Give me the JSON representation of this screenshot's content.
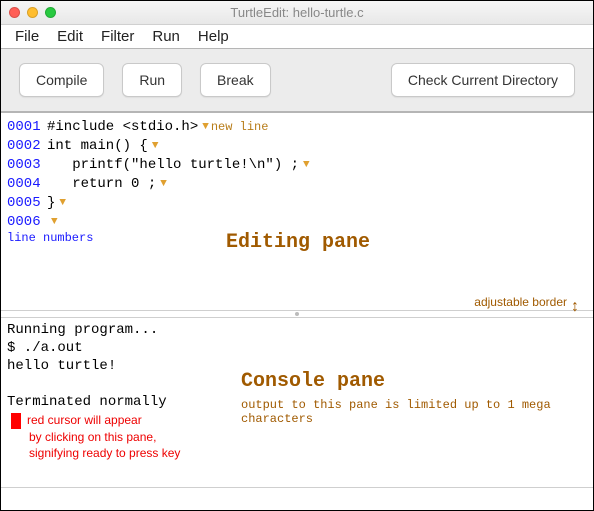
{
  "window": {
    "title": "TurtleEdit: hello-turtle.c"
  },
  "menubar": {
    "items": [
      "File",
      "Edit",
      "Filter",
      "Run",
      "Help"
    ]
  },
  "toolbar": {
    "compile": "Compile",
    "run": "Run",
    "break": "Break",
    "check": "Check Current Directory"
  },
  "editor": {
    "lines": [
      {
        "n": "0001",
        "code": "#include <stdio.h>",
        "tri": true,
        "annot": "new line"
      },
      {
        "n": "0002",
        "code": "int main() {",
        "tri": true
      },
      {
        "n": "0003",
        "code": "   printf(\"hello turtle!\\n\") ;",
        "tri": true
      },
      {
        "n": "0004",
        "code": "   return 0 ;",
        "tri": true
      },
      {
        "n": "0005",
        "code": "}",
        "tri": true
      },
      {
        "n": "0006",
        "code": "",
        "tri": true
      }
    ],
    "line_numbers_label": "line numbers",
    "pane_label": "Editing pane",
    "adjustable_label": "adjustable border"
  },
  "console": {
    "lines": [
      "Running program...",
      "$ ./a.out",
      "hello turtle!",
      "",
      "Terminated normally"
    ],
    "cursor_note": [
      "red cursor will appear",
      "by clicking on this pane,",
      "signifying ready to press key"
    ],
    "pane_label": "Console pane",
    "limit_label": "output to this pane is limited up to 1 mega characters"
  }
}
